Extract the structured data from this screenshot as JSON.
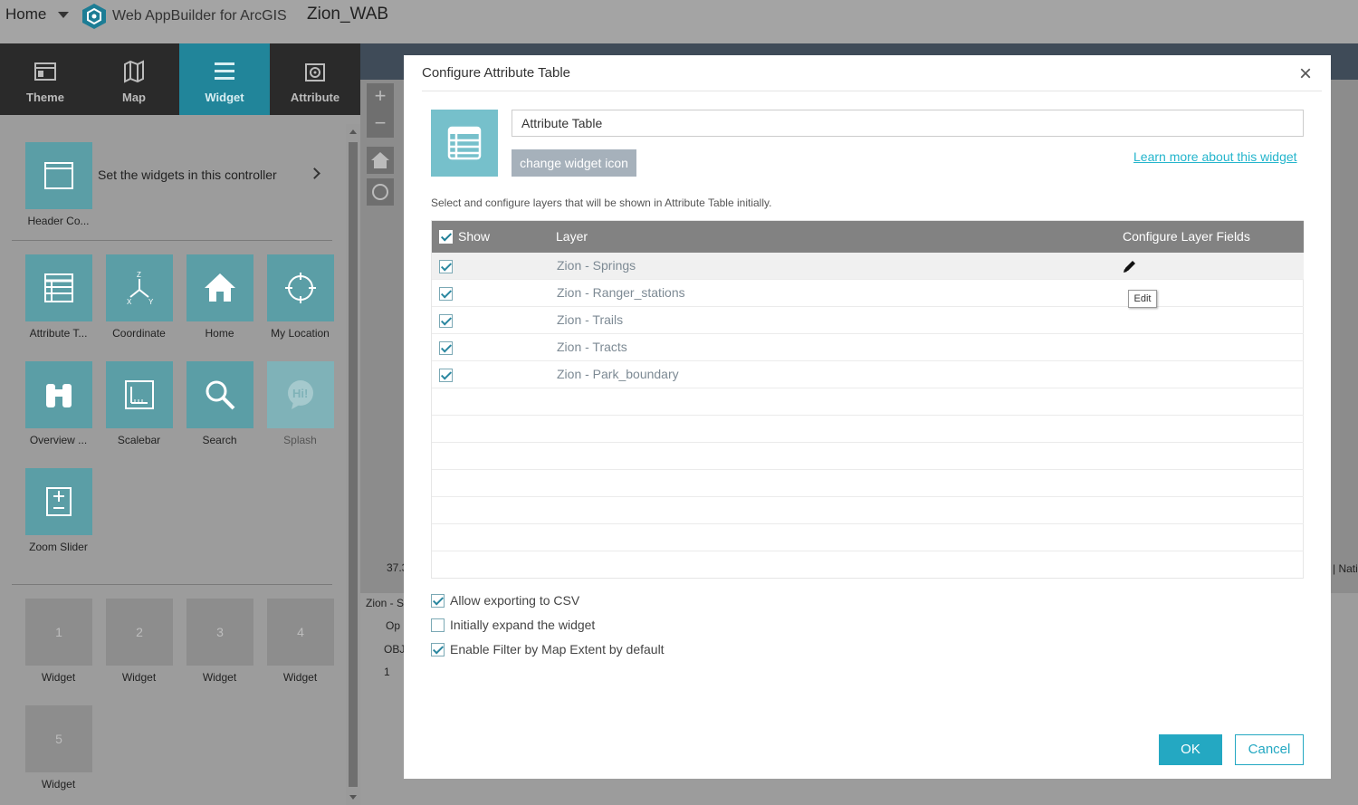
{
  "topbar": {
    "home": "Home",
    "app_name": "Web AppBuilder for ArcGIS",
    "project": "Zion_WAB"
  },
  "tabs": [
    {
      "label": "Theme",
      "icon": "theme-icon"
    },
    {
      "label": "Map",
      "icon": "map-icon"
    },
    {
      "label": "Widget",
      "icon": "widget-icon",
      "active": true
    },
    {
      "label": "Attribute",
      "icon": "attribute-icon"
    }
  ],
  "controller": {
    "label": "Header Co...",
    "text": "Set the widgets in this controller"
  },
  "widgets": [
    {
      "label": "Attribute T...",
      "icon": "table-icon"
    },
    {
      "label": "Coordinate",
      "icon": "coordinate-icon"
    },
    {
      "label": "Home",
      "icon": "home-icon"
    },
    {
      "label": "My Location",
      "icon": "location-icon"
    },
    {
      "label": "Overview ...",
      "icon": "binoculars-icon"
    },
    {
      "label": "Scalebar",
      "icon": "scalebar-icon"
    },
    {
      "label": "Search",
      "icon": "search-icon"
    },
    {
      "label": "Splash",
      "icon": "splash-icon",
      "disabled": true
    },
    {
      "label": "Zoom Slider",
      "icon": "zoom-slider-icon"
    }
  ],
  "placeholders": [
    {
      "number": "1",
      "label": "Widget"
    },
    {
      "number": "2",
      "label": "Widget"
    },
    {
      "number": "3",
      "label": "Widget"
    },
    {
      "number": "4",
      "label": "Widget"
    },
    {
      "number": "5",
      "label": "Widget"
    }
  ],
  "map": {
    "zoom_in": "+",
    "zoom_out": "−",
    "coord_text": "37.3",
    "attribution_text": "| Nati",
    "table_tab": "Zion - S",
    "options_text": "Op",
    "col_header": "OBJ",
    "row_value": "1"
  },
  "dialog": {
    "title": "Configure Attribute Table",
    "close": "×",
    "widget_name": "Attribute Table",
    "change_icon_label": "change widget icon",
    "learn_more": "Learn more about this widget",
    "description": "Select and configure layers that will be shown in Attribute Table initially.",
    "table": {
      "col_show": "Show",
      "col_layer": "Layer",
      "col_fields": "Configure Layer Fields",
      "rows": [
        {
          "layer": "Zion - Springs",
          "checked": true
        },
        {
          "layer": "Zion - Ranger_stations",
          "checked": true
        },
        {
          "layer": "Zion - Trails",
          "checked": true
        },
        {
          "layer": "Zion - Tracts",
          "checked": true
        },
        {
          "layer": "Zion - Park_boundary",
          "checked": true
        }
      ],
      "tooltip": "Edit"
    },
    "options": [
      {
        "label": "Allow exporting to CSV",
        "checked": true
      },
      {
        "label": "Initially expand the widget",
        "checked": false
      },
      {
        "label": "Enable Filter by Map Extent by default",
        "checked": true
      }
    ],
    "ok_label": "OK",
    "cancel_label": "Cancel"
  },
  "colors": {
    "accent": "#24a8c2",
    "widget_tile": "#5b9ea6",
    "active_tab": "#21859a",
    "table_header": "#828282"
  }
}
